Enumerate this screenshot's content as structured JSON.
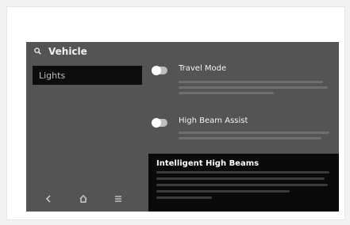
{
  "header": {
    "title": "Vehicle",
    "search_icon": "search-icon"
  },
  "sidebar": {
    "items": [
      {
        "label": "Lights",
        "selected": true
      }
    ]
  },
  "settings": [
    {
      "label": "Travel Mode",
      "enabled": false
    },
    {
      "label": "High Beam Assist",
      "enabled": false
    }
  ],
  "tooltip": {
    "title": "Intelligent High Beams"
  },
  "bottom_nav": {
    "icons": [
      "back-icon",
      "home-icon",
      "menu-icon"
    ]
  },
  "colors": {
    "screen_bg": "#545454",
    "selected_bg": "#0d0d0d",
    "tooltip_bg": "#0a0a0a",
    "text": "#f0f0f0"
  }
}
